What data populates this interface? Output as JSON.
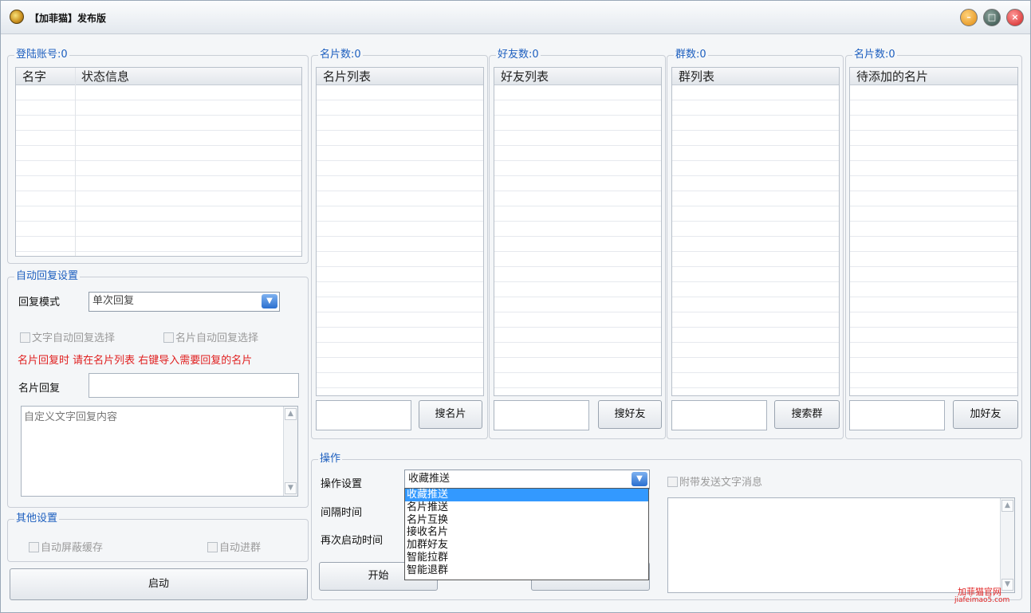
{
  "window": {
    "title": "【加菲猫】发布版"
  },
  "login": {
    "group": "登陆账号:0",
    "col_name": "名字",
    "col_status": "状态信息"
  },
  "cards": {
    "group": "名片数:0",
    "header": "名片列表",
    "search_button": "搜名片"
  },
  "friends": {
    "group": "好友数:0",
    "header": "好友列表",
    "search_button": "搜好友"
  },
  "groups": {
    "group": "群数:0",
    "header": "群列表",
    "search_button": "搜索群"
  },
  "pending": {
    "group": "名片数:0",
    "header": "待添加的名片",
    "add_button": "加好友"
  },
  "auto_reply": {
    "group": "自动回复设置",
    "mode_label": "回复模式",
    "mode_value": "单次回复",
    "text_auto": "文字自动回复选择",
    "card_auto": "名片自动回复选择",
    "hint": "名片回复时 请在名片列表 右键导入需要回复的名片",
    "card_reply_label": "名片回复",
    "custom_placeholder": "自定义文字回复内容"
  },
  "other": {
    "group": "其他设置",
    "block_cache": "自动屏蔽缓存",
    "auto_join": "自动进群"
  },
  "start_button": "启动",
  "operation": {
    "group": "操作",
    "setting_label": "操作设置",
    "setting_value": "收藏推送",
    "interval_label": "间隔时间",
    "restart_label": "再次启动时间",
    "start_button": "开始",
    "attach_text": "附带发送文字消息",
    "options": [
      "收藏推送",
      "名片推送",
      "名片互换",
      "接收名片",
      "加群好友",
      "智能拉群",
      "智能退群"
    ]
  },
  "watermark": {
    "line1": "加菲猫官网",
    "line2": "jiafeimao5.com"
  }
}
